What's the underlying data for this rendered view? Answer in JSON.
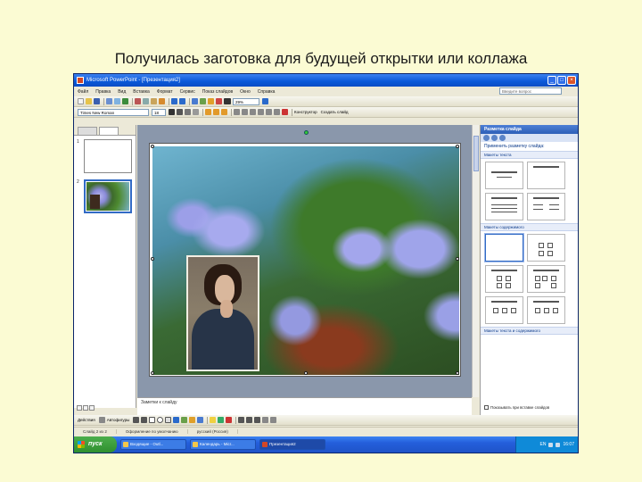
{
  "caption": "Получилась заготовка для будущей открытки или коллажа",
  "window": {
    "title": "Microsoft PowerPoint - [Презентация2]",
    "controls": {
      "minimize": "_",
      "maximize": "□",
      "close": "×"
    }
  },
  "menubar": {
    "items": [
      "Файл",
      "Правка",
      "Вид",
      "Вставка",
      "Формат",
      "Сервис",
      "Показ слайдов",
      "Окно",
      "Справка"
    ],
    "help_placeholder": "Введите вопрос"
  },
  "toolbar": {
    "zoom": "29%",
    "font_name": "Times New Roman",
    "font_size": "18",
    "constructor_label": "Конструктор",
    "create_slide_label": "Создать слайд"
  },
  "slides_pane": {
    "numbers": [
      "1",
      "2"
    ]
  },
  "notes": {
    "text": "Заметки к слайду"
  },
  "task_pane": {
    "header": "Разметка слайда",
    "subtitle": "Применить разметку слайда:",
    "sections": {
      "text_layouts": "Макеты текста",
      "content_layouts": "Макеты содержимого",
      "text_content_layouts": "Макеты текста и содержимого"
    },
    "footer_checkbox": "Показывать при вставке слайдов"
  },
  "drawbar": {
    "draw_label": "Действия",
    "autoshapes_label": "Автофигуры"
  },
  "statusbar": {
    "slide": "Слайд 2 из 2",
    "design": "Оформление по умолчанию",
    "language": "русский (Россия)"
  },
  "taskbar": {
    "start": "пуск",
    "buttons": [
      "Входящие - Outl...",
      "Календарь - Micr...",
      "Презентация2"
    ],
    "tray_lang": "EN",
    "clock": "16:07"
  },
  "colors": {
    "titlebar": "#0a58d8",
    "taskbar": "#245edb",
    "start": "#2f8f2f",
    "background": "#fbfbd3"
  }
}
